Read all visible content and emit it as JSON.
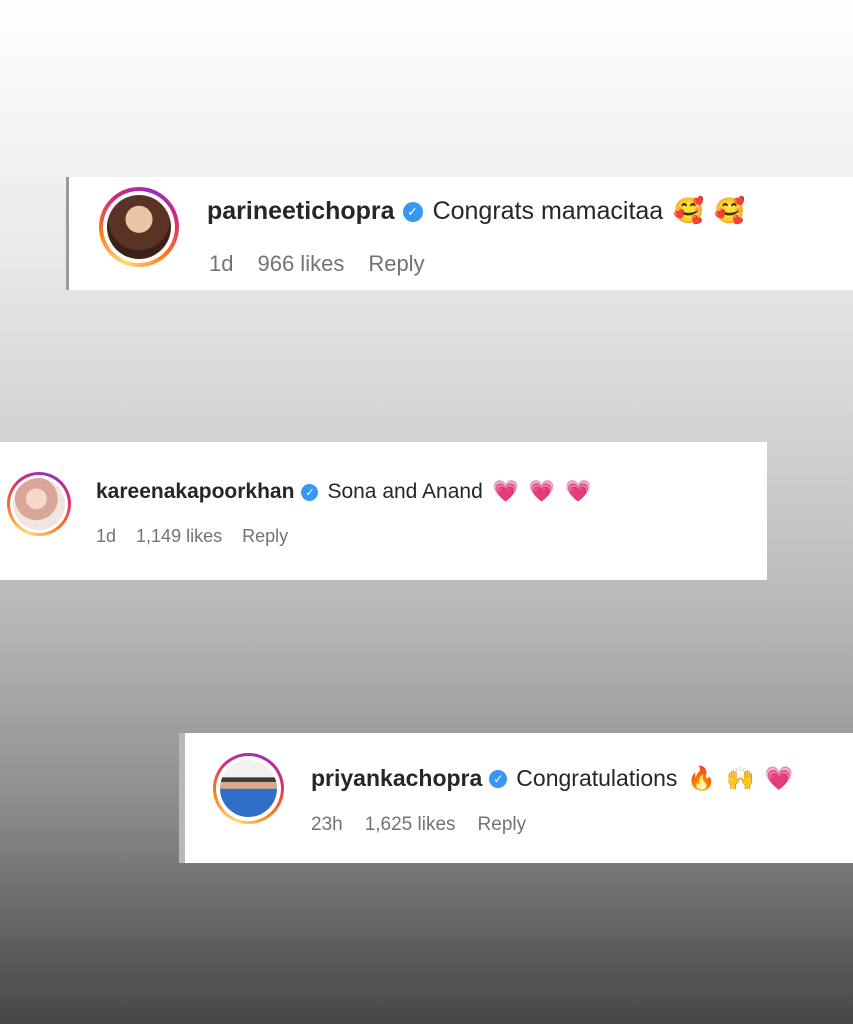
{
  "comments": [
    {
      "username": "parineetichopra",
      "verified_glyph": "✓",
      "text": "Congrats mamacitaa",
      "emojis": [
        "🥰",
        "🥰"
      ],
      "time": "1d",
      "likes": "966 likes",
      "reply_label": "Reply"
    },
    {
      "username": "kareenakapoorkhan",
      "verified_glyph": "✓",
      "text": "Sona and Anand",
      "emojis": [
        "💗",
        "💗",
        "💗"
      ],
      "time": "1d",
      "likes": "1,149 likes",
      "reply_label": "Reply"
    },
    {
      "username": "priyankachopra",
      "verified_glyph": "✓",
      "text": "Congratulations",
      "emojis": [
        "🔥",
        "🙌",
        "💗"
      ],
      "time": "23h",
      "likes": "1,625 likes",
      "reply_label": "Reply"
    }
  ],
  "colors": {
    "username": "#262626",
    "meta": "#737373",
    "verified": "#3897f0",
    "story_ring": [
      "#feda75",
      "#fa7e1e",
      "#d62976",
      "#962fbf"
    ]
  },
  "icons": [
    "verified-badge-icon",
    "story-ring-avatar"
  ]
}
